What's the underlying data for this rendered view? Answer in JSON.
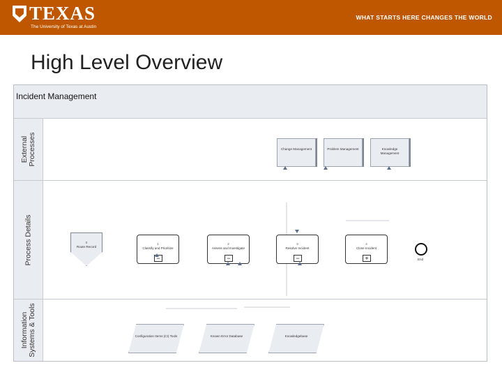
{
  "header": {
    "logo_word": "TEXAS",
    "logo_sub": "The University of Texas at Austin",
    "tagline": "WHAT STARTS HERE CHANGES THE WORLD",
    "brand_color": "#bf5700"
  },
  "slide": {
    "title": "High Level Overview"
  },
  "diagram": {
    "pool_title": "Incident Management",
    "lanes": {
      "external": "External\nProcesses",
      "process": "Process Details",
      "systems": "Information\nSystems & Tools"
    },
    "external_processes": [
      {
        "label": "Change Management"
      },
      {
        "label": "Problem Management"
      },
      {
        "label": "Knowledge Management"
      }
    ],
    "start": {
      "num": "0",
      "label": "Route Record"
    },
    "tasks": [
      {
        "num": "1",
        "label": "Classify and Prioritize",
        "marker": "−"
      },
      {
        "num": "2",
        "label": "Assess and Investigate",
        "marker": "−"
      },
      {
        "num": "3",
        "label": "Resolve Incident",
        "marker": "−"
      },
      {
        "num": "4",
        "label": "Close Incident",
        "marker": "+"
      }
    ],
    "end": {
      "label": "End"
    },
    "systems": [
      {
        "label": "Configuration Items (CI) Tools"
      },
      {
        "label": "Known Error Database"
      },
      {
        "label": "Knowledgebase"
      }
    ]
  }
}
